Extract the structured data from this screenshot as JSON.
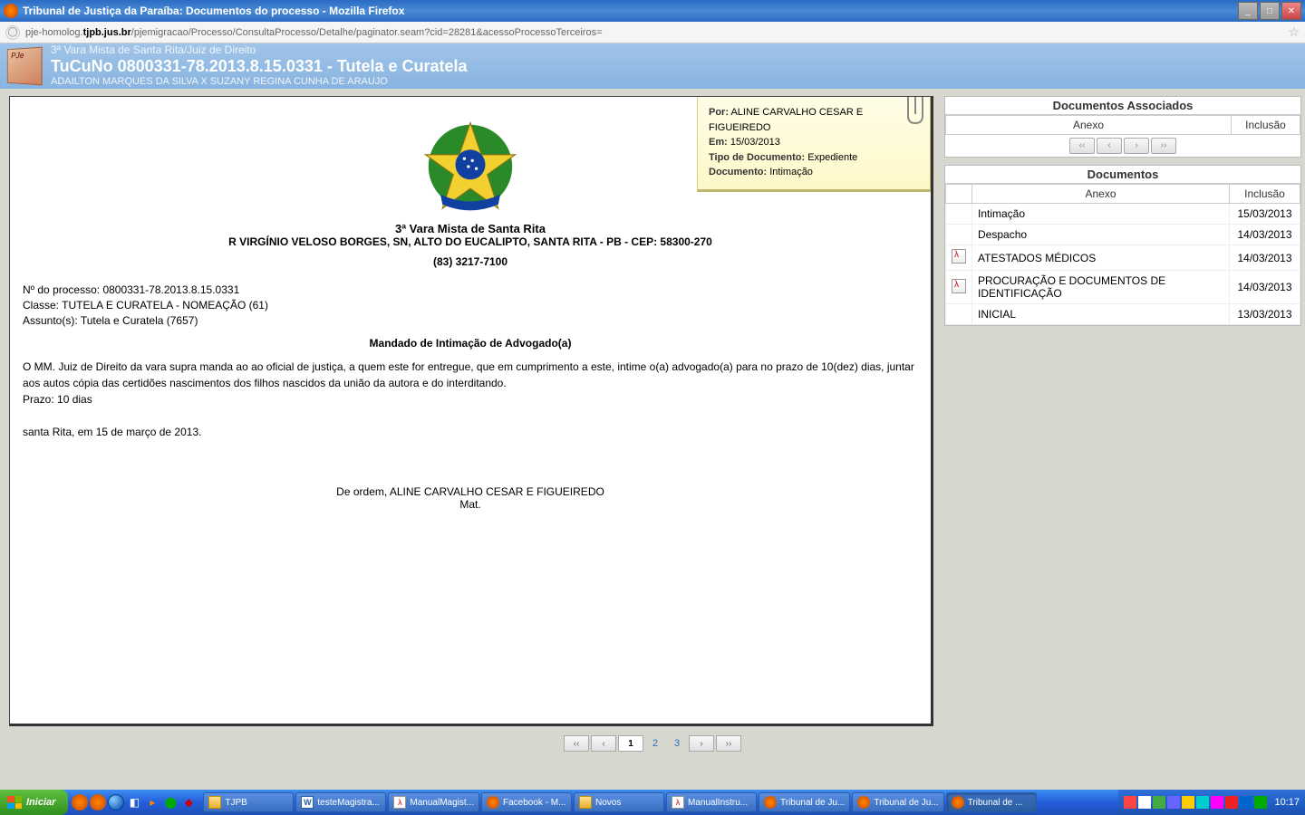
{
  "window": {
    "title": "Tribunal de Justiça da Paraíba: Documentos do processo - Mozilla Firefox"
  },
  "address": {
    "url_pre": "pje-homolog.",
    "url_bold": "tjpb.jus.br",
    "url_post": "/pjemigracao/Processo/ConsultaProcesso/Detalhe/paginator.seam?cid=28281&acessoProcessoTerceiros="
  },
  "banner": {
    "line1": "3ª Vara Mista de Santa Rita/Juiz de Direito",
    "line2": "TuCuNo 0800331-78.2013.8.15.0331 - Tutela e Curatela",
    "line3": "ADAILTON MARQUES DA SILVA X SUZANY REGINA CUNHA DE ARAUJO"
  },
  "sticky": {
    "por_label": "Por:",
    "por_value": "ALINE CARVALHO CESAR E FIGUEIREDO",
    "em_label": "Em:",
    "em_value": "15/03/2013",
    "tipo_label": "Tipo de Documento:",
    "tipo_value": "Expediente",
    "doc_label": "Documento:",
    "doc_value": "Intimação"
  },
  "document": {
    "court": "3ª Vara Mista de Santa Rita",
    "address": "R VIRGÍNIO VELOSO BORGES, SN, ALTO DO EUCALIPTO, SANTA RITA - PB - CEP: 58300-270",
    "phone": "(83) 3217-7100",
    "proc_label": "Nº do processo: ",
    "proc_value": "0800331-78.2013.8.15.0331",
    "classe_label": "Classe: ",
    "classe_value": "TUTELA E CURATELA - NOMEAÇÃO (61)",
    "assunto_label": "Assunto(s): ",
    "assunto_value": "Tutela e Curatela (7657)",
    "title": "Mandado de Intimação de Advogado(a)",
    "body1": "O MM. Juiz de Direito da vara supra manda ao ao oficial de justiça, a quem este for entregue, que em cumprimento a este, intime o(a) advogado(a) para no prazo de 10(dez) dias, juntar aos autos cópia das certidões nascimentos dos filhos nascidos da união da autora e do interditando.",
    "prazo": "Prazo: 10 dias",
    "local_date": "santa Rita, em 15 de março de 2013.",
    "sign1": "De ordem, ALINE CARVALHO CESAR E FIGUEIREDO",
    "sign2": "Mat."
  },
  "right": {
    "assoc_title": "Documentos Associados",
    "anexo_header": "Anexo",
    "inclusao_header": "Inclusão",
    "docs_title": "Documentos",
    "nav_first": "‹‹",
    "nav_prev": "‹",
    "nav_next": "›",
    "nav_last": "››",
    "rows": [
      {
        "has_pdf": false,
        "name": "Intimação",
        "date": "15/03/2013"
      },
      {
        "has_pdf": false,
        "name": "Despacho",
        "date": "14/03/2013"
      },
      {
        "has_pdf": true,
        "name": "ATESTADOS MÉDICOS",
        "date": "14/03/2013"
      },
      {
        "has_pdf": true,
        "name": "PROCURAÇÃO E DOCUMENTOS DE IDENTIFICAÇÃO",
        "date": "14/03/2013"
      },
      {
        "has_pdf": false,
        "name": "INICIAL",
        "date": "13/03/2013"
      }
    ]
  },
  "pagination": {
    "first": "‹‹",
    "prev": "‹",
    "p1": "1",
    "p2": "2",
    "p3": "3",
    "next": "›",
    "last": "››"
  },
  "taskbar": {
    "start": "Iniciar",
    "tasks": [
      {
        "icon": "folder",
        "label": "TJPB"
      },
      {
        "icon": "word",
        "label": "testeMagistra..."
      },
      {
        "icon": "pdf",
        "label": "ManualMagist..."
      },
      {
        "icon": "ff",
        "label": "Facebook - M..."
      },
      {
        "icon": "folder",
        "label": "Novos"
      },
      {
        "icon": "pdf",
        "label": "ManualInstru..."
      },
      {
        "icon": "ff",
        "label": "Tribunal de Ju..."
      },
      {
        "icon": "ff",
        "label": "Tribunal de Ju..."
      },
      {
        "icon": "ff",
        "label": "Tribunal de ...",
        "active": true
      }
    ],
    "clock": "10:17"
  }
}
